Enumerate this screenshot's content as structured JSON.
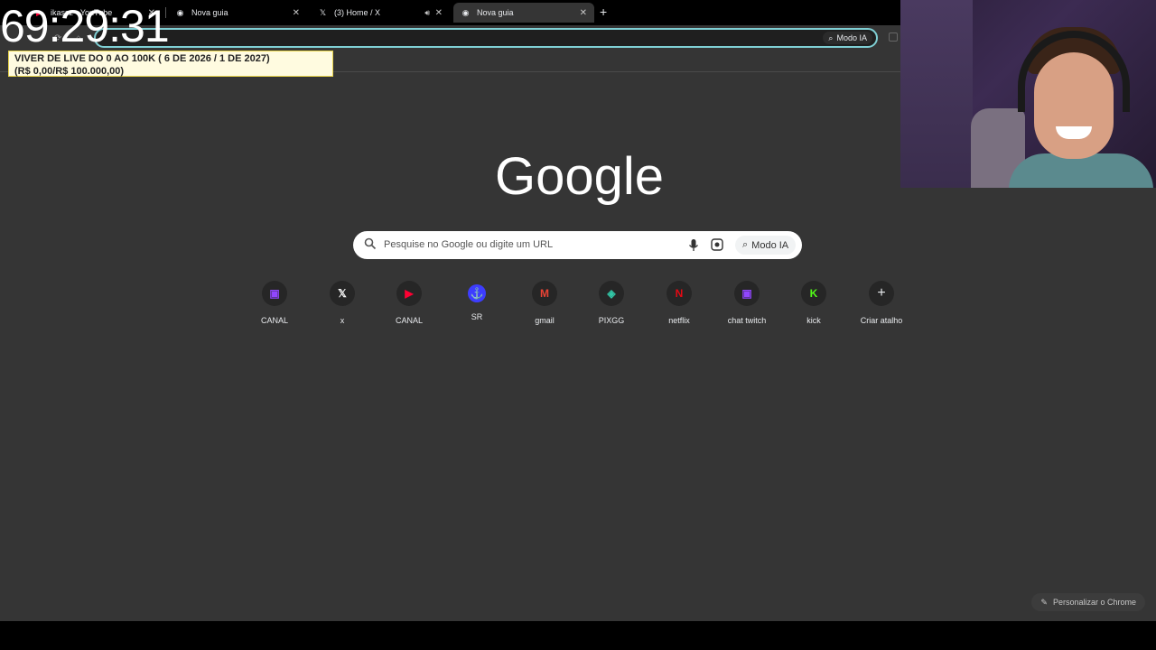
{
  "overlay": {
    "clock": "69:29:31",
    "goal_line1": "VIVER DE LIVE DO 0 AO 100K ( 6 DE 2026 / 1 DE 2027)",
    "goal_line2": "(R$ 0,00/R$ 100.000,00)"
  },
  "tabs": [
    {
      "title": "ikassz - YouTube",
      "icon": "youtube-icon"
    },
    {
      "title": "Nova guia",
      "icon": "chrome-icon"
    },
    {
      "title": "(3) Home / X",
      "icon": "x-icon"
    },
    {
      "title": "Nova guia",
      "icon": "chrome-icon",
      "active": true
    }
  ],
  "toolbar": {
    "modo_ia": "Modo IA"
  },
  "ntp": {
    "logo": "Google",
    "search_placeholder": "Pesquise no Google ou digite um URL",
    "modo_ia": "Modo IA",
    "shortcuts": [
      {
        "label": "CANAL",
        "icon": "twitch-icon",
        "color": "#9146ff"
      },
      {
        "label": "x",
        "icon": "x-icon",
        "color": "#ffffff"
      },
      {
        "label": "CANAL",
        "icon": "youtube-icon",
        "color": "#ff0033"
      },
      {
        "label": "SR",
        "icon": "sr-icon",
        "color": "#3d3dff"
      },
      {
        "label": "gmail",
        "icon": "gmail-icon",
        "color": "#ea4335"
      },
      {
        "label": "PIXGG",
        "icon": "pixgg-icon",
        "color": "#32c8a8"
      },
      {
        "label": "netflix",
        "icon": "netflix-icon",
        "color": "#e50914"
      },
      {
        "label": "chat twitch",
        "icon": "twitch-icon",
        "color": "#9146ff"
      },
      {
        "label": "kick",
        "icon": "kick-icon",
        "color": "#53fc18"
      },
      {
        "label": "Criar atalho",
        "icon": "plus-icon",
        "color": "#e8eaed"
      }
    ],
    "customize": "Personalizar o Chrome"
  }
}
